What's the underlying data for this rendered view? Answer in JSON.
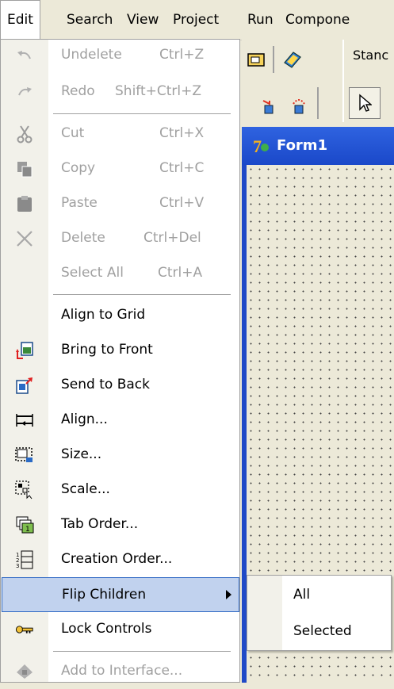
{
  "menubar": {
    "items": [
      "Edit",
      "Search",
      "View",
      "Project",
      "Run",
      "Compone"
    ]
  },
  "toolbar": {
    "standard_label": "Stanc"
  },
  "form": {
    "title": "Form1"
  },
  "edit_menu": {
    "items": [
      {
        "label": "Undelete",
        "shortcut": "Ctrl+Z",
        "icon": "undo-icon"
      },
      {
        "label": "Redo",
        "shortcut": "Shift+Ctrl+Z",
        "icon": "redo-icon"
      },
      {
        "label": "Cut",
        "shortcut": "Ctrl+X",
        "icon": "scissors-icon"
      },
      {
        "label": "Copy",
        "shortcut": "Ctrl+C",
        "icon": "copy-icon"
      },
      {
        "label": "Paste",
        "shortcut": "Ctrl+V",
        "icon": "paste-icon"
      },
      {
        "label": "Delete",
        "shortcut": "Ctrl+Del",
        "icon": "delete-x-icon"
      },
      {
        "label": "Select All",
        "shortcut": "Ctrl+A"
      },
      {
        "label": "Align to Grid"
      },
      {
        "label": "Bring to Front",
        "icon": "bring-to-front-icon"
      },
      {
        "label": "Send to Back",
        "icon": "send-to-back-icon"
      },
      {
        "label": "Align...",
        "icon": "align-icon"
      },
      {
        "label": "Size...",
        "icon": "size-icon"
      },
      {
        "label": "Scale...",
        "icon": "scale-icon"
      },
      {
        "label": "Tab Order...",
        "icon": "tab-order-icon"
      },
      {
        "label": "Creation Order...",
        "icon": "creation-order-icon"
      },
      {
        "label": "Flip Children"
      },
      {
        "label": "Lock Controls",
        "icon": "key-icon"
      },
      {
        "label": "Add to Interface...",
        "icon": "add-interface-icon"
      }
    ]
  },
  "flip_submenu": {
    "items": [
      "All",
      "Selected"
    ]
  },
  "colors": {
    "highlight_fill": "#c1d2ee",
    "highlight_border": "#316ac5",
    "disabled_text": "#a0a0a0",
    "title_bar": "#1f49c7"
  }
}
